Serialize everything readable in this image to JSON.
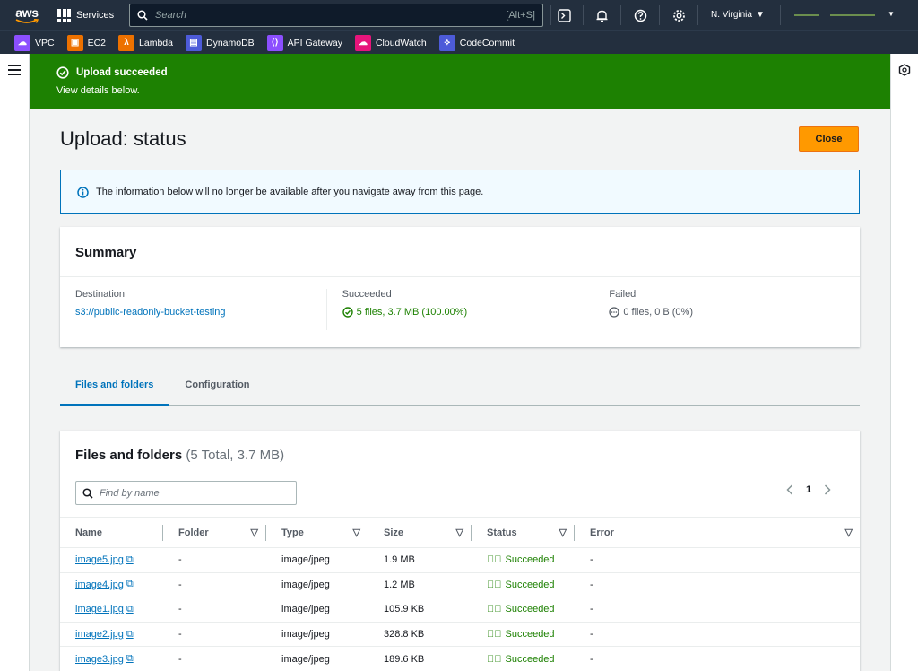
{
  "topnav": {
    "logo_text": "aws",
    "services_label": "Services",
    "search_placeholder": "Search",
    "search_shortcut": "[Alt+S]",
    "region": "N. Virginia"
  },
  "favorites": [
    {
      "label": "VPC",
      "color": "#8c4fff",
      "glyph": "☁"
    },
    {
      "label": "EC2",
      "color": "#ed7100",
      "glyph": "▣"
    },
    {
      "label": "Lambda",
      "color": "#ed7100",
      "glyph": "λ"
    },
    {
      "label": "DynamoDB",
      "color": "#4d5bd9",
      "glyph": "▤"
    },
    {
      "label": "API Gateway",
      "color": "#8c4fff",
      "glyph": "⟨⟩"
    },
    {
      "label": "CloudWatch",
      "color": "#e7157b",
      "glyph": "☁"
    },
    {
      "label": "CodeCommit",
      "color": "#4d5bd9",
      "glyph": "⟡"
    }
  ],
  "flash": {
    "title": "Upload succeeded",
    "subtitle": "View details below."
  },
  "page": {
    "title": "Upload: status",
    "close_label": "Close",
    "info_text": "The information below will no longer be available after you navigate away from this page."
  },
  "summary": {
    "heading": "Summary",
    "destination_label": "Destination",
    "destination_value": "s3://public-readonly-bucket-testing",
    "succeeded_label": "Succeeded",
    "succeeded_value": "5 files, 3.7 MB (100.00%)",
    "failed_label": "Failed",
    "failed_value": "0 files, 0 B (0%)"
  },
  "tabs": [
    {
      "label": "Files and folders",
      "active": true
    },
    {
      "label": "Configuration",
      "active": false
    }
  ],
  "files": {
    "heading": "Files and folders",
    "count": "(5 Total, 3.7 MB)",
    "find_placeholder": "Find by name",
    "page_number": "1",
    "columns": [
      "Name",
      "Folder",
      "Type",
      "Size",
      "Status",
      "Error"
    ],
    "rows": [
      {
        "name": "image5.jpg",
        "folder": "-",
        "type": "image/jpeg",
        "size": "1.9 MB",
        "status": "Succeeded",
        "error": "-"
      },
      {
        "name": "image4.jpg",
        "folder": "-",
        "type": "image/jpeg",
        "size": "1.2 MB",
        "status": "Succeeded",
        "error": "-"
      },
      {
        "name": "image1.jpg",
        "folder": "-",
        "type": "image/jpeg",
        "size": "105.9 KB",
        "status": "Succeeded",
        "error": "-"
      },
      {
        "name": "image2.jpg",
        "folder": "-",
        "type": "image/jpeg",
        "size": "328.8 KB",
        "status": "Succeeded",
        "error": "-"
      },
      {
        "name": "image3.jpg",
        "folder": "-",
        "type": "image/jpeg",
        "size": "189.6 KB",
        "status": "Succeeded",
        "error": "-"
      }
    ]
  },
  "colors": {
    "nav_bg": "#232f3e",
    "success": "#1d8102",
    "link": "#0073bb",
    "primary_button": "#ff9900"
  }
}
